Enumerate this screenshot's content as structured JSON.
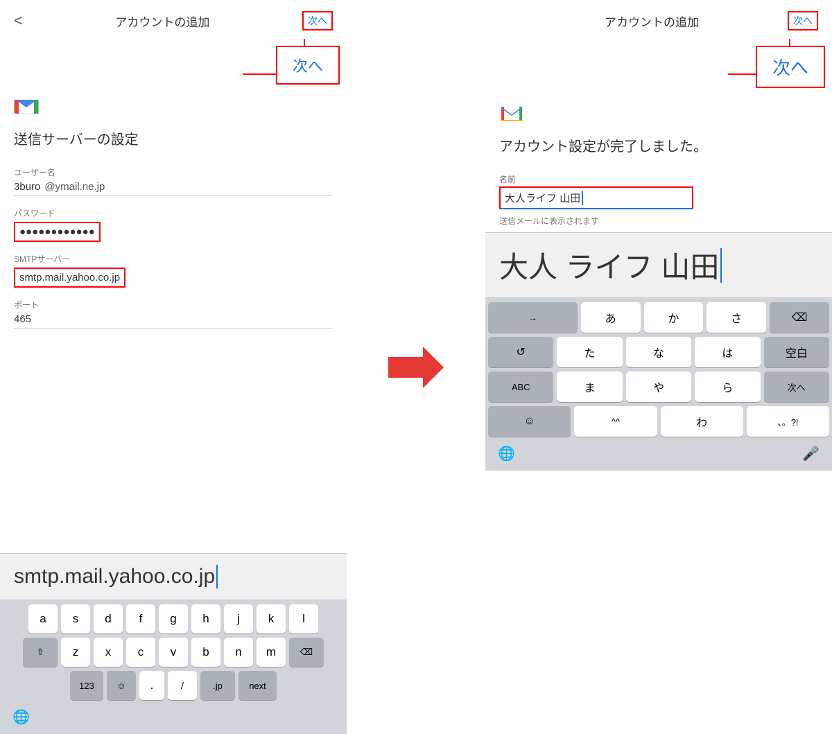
{
  "left_panel": {
    "title": "アカウントの追加",
    "back_label": "<",
    "next_label": "次へ",
    "next_callout": "次へ",
    "gmail_page_title": "送信サーバーの設定",
    "username_label": "ユーザー名",
    "username_value": "3buro",
    "username_domain": "@ymail.ne.jp",
    "password_label": "パスワード",
    "password_value": "●●●●●●●●●●●●",
    "smtp_label": "SMTPサーバー",
    "smtp_value": "smtp.mail.yahoo.co.jp",
    "port_label": "ポート",
    "port_value": "465",
    "large_text": "smtp.mail.yahoo.co.jp",
    "keyboard": {
      "row1": [
        "a",
        "s",
        "d",
        "f",
        "g",
        "h",
        "j",
        "k",
        "l"
      ],
      "row2": [
        "z",
        "x",
        "c",
        "v",
        "b",
        "n",
        "m"
      ],
      "row3_left": "123",
      "row3_emoji": "☺",
      "row3_dot": ".",
      "row3_slash": "/",
      "row3_jp": ".jp",
      "row3_next": "next",
      "shift": "⇧",
      "delete": "⌫"
    }
  },
  "right_panel": {
    "title": "アカウントの追加",
    "next_label": "次へ",
    "next_callout": "次へ",
    "gmail_page_title": "アカウント設定が完了しました。",
    "name_label": "名前",
    "name_value": "大人ライフ 山田",
    "sub_label": "送信メールに表示されます",
    "large_text": "大人 ライフ 山田",
    "jp_keyboard": {
      "row1": [
        "→",
        "あ",
        "か",
        "さ",
        "⌫"
      ],
      "row2": [
        "↺",
        "た",
        "な",
        "は",
        "空白"
      ],
      "row3": [
        "ABC",
        "ま",
        "や",
        "ら",
        "次へ"
      ],
      "row4": [
        "☺",
        "^^",
        "わ",
        "、。?!"
      ]
    }
  },
  "arrow": "→"
}
